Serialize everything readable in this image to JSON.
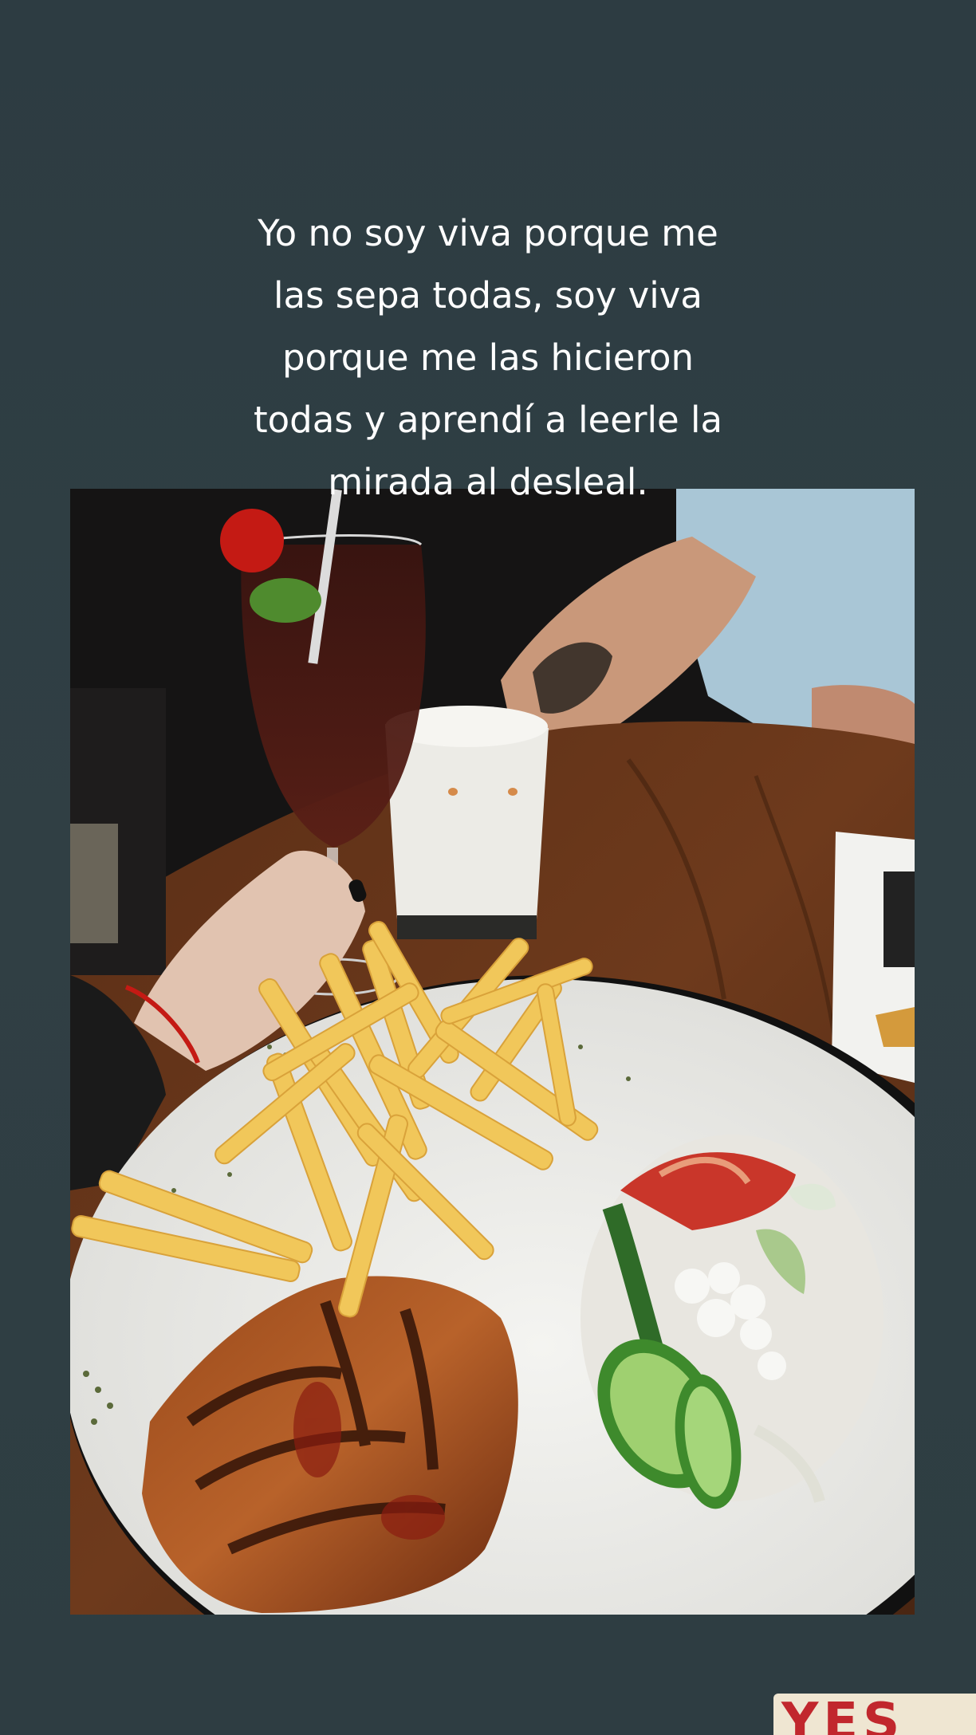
{
  "story": {
    "background_color": "#2f3e43",
    "caption": "Yo no soy viva porque me\nlas sepa todas, soy viva\nporque me las hicieron\ntodas y aprendí a leerle la\nmirada al desleal.",
    "caption_color": "#ffffff"
  },
  "photo": {
    "description_icon": "food-photo-image"
  },
  "sticker": {
    "text": "YES",
    "text_color": "#c1272d",
    "background_color": "#efe6d2"
  }
}
